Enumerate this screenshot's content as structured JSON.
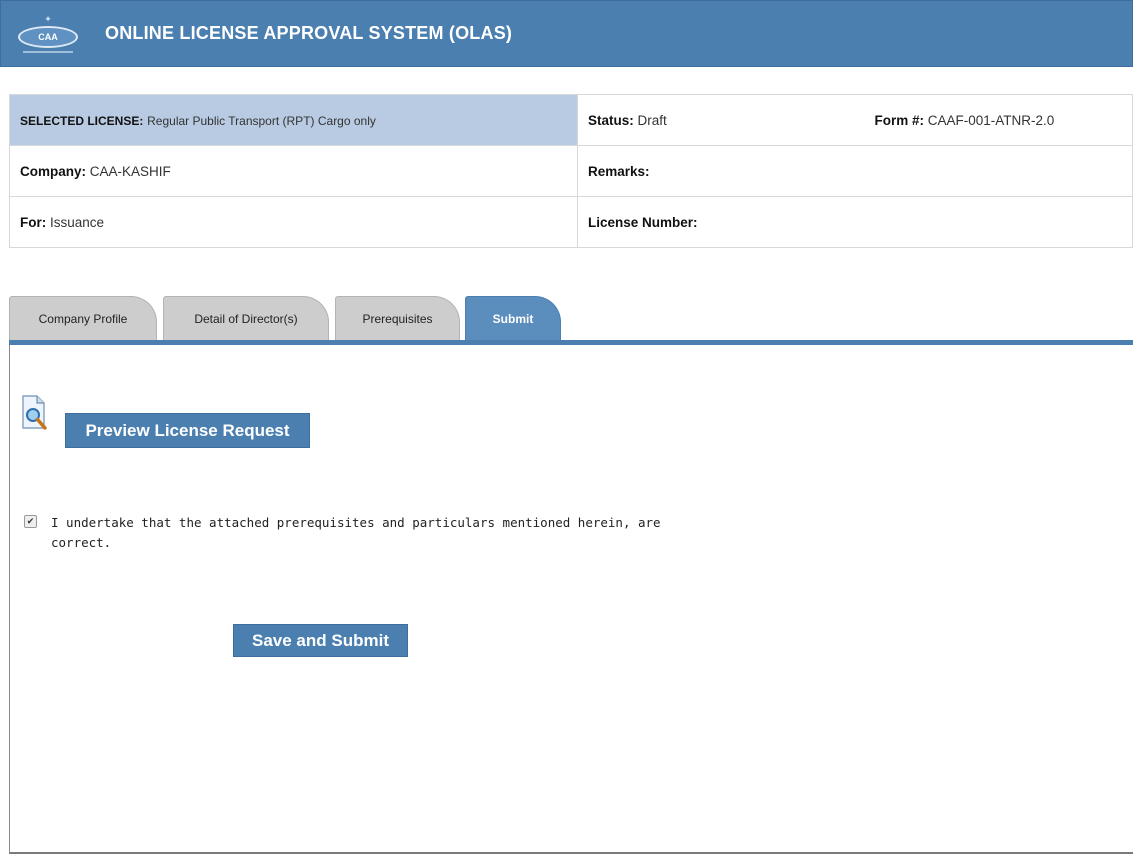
{
  "app": {
    "title": "ONLINE LICENSE APPROVAL SYSTEM (OLAS)",
    "logo_text": "CAA"
  },
  "license_info": {
    "selected_license_label": "SELECTED LICENSE:",
    "selected_license_value": "Regular Public Transport (RPT) Cargo only",
    "status_label": "Status:",
    "status_value": "Draft",
    "form_label": "Form #:",
    "form_value": "CAAF-001-ATNR-2.0",
    "company_label": "Company:",
    "company_value": "CAA-KASHIF",
    "remarks_label": "Remarks:",
    "remarks_value": "",
    "for_label": "For:",
    "for_value": "Issuance",
    "license_number_label": "License Number:",
    "license_number_value": ""
  },
  "tabs": [
    {
      "label": "Company Profile",
      "active": false
    },
    {
      "label": "Detail of Director(s)",
      "active": false
    },
    {
      "label": "Prerequisites",
      "active": false
    },
    {
      "label": "Submit",
      "active": true
    }
  ],
  "submit_panel": {
    "preview_label": "Preview License Request",
    "undertaking_checked": true,
    "undertaking_text": "I undertake that the attached prerequisites and particulars mentioned herein, are correct.",
    "save_submit_label": "Save and Submit"
  },
  "colors": {
    "header_blue": "#4a7fb0",
    "selected_cell": "#b8cbe2",
    "inactive_tab": "#cdcdcd"
  },
  "icons": {
    "logo": "caa-logo",
    "preview": "document-magnifier-icon",
    "checkbox": "checkbox-checked-icon"
  }
}
